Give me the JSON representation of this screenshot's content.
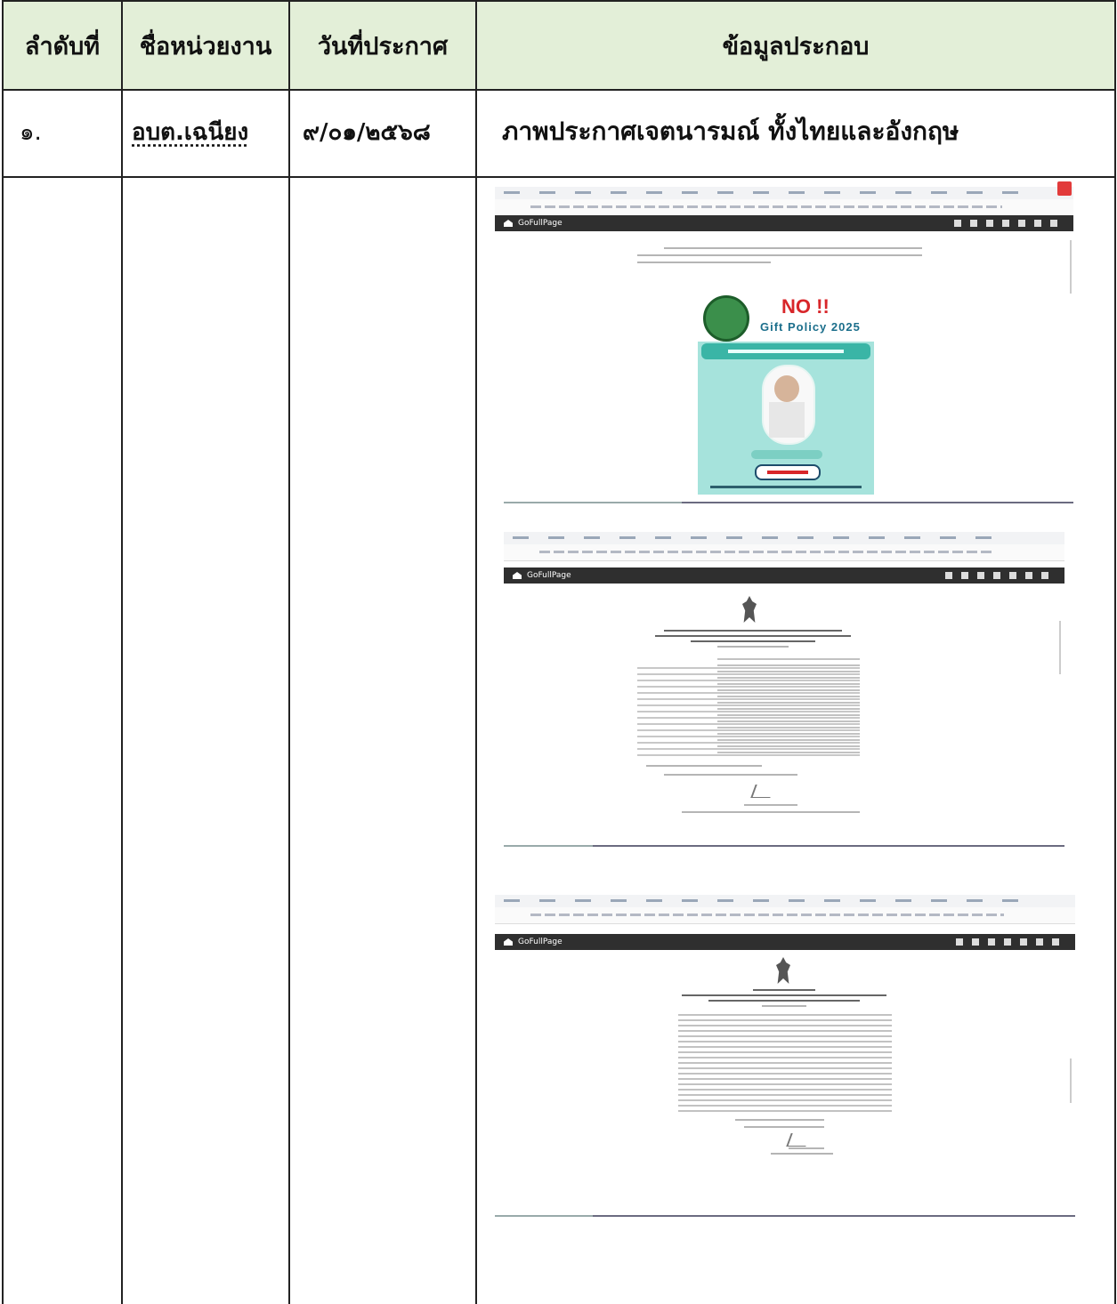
{
  "table": {
    "headers": {
      "order": "ลำดับที่",
      "unit": "ชื่อหน่วยงาน",
      "date": "วันที่ประกาศ",
      "info": "ข้อมูลประกอบ"
    },
    "rows": [
      {
        "order": "๑.",
        "unit": "อบต.เฉนียง",
        "date": "๙/๐๑/๒๕๖๘",
        "info": "ภาพประกาศเจตนารมณ์ ทั้งไทยและอังกฤษ"
      }
    ]
  },
  "screenshots": [
    {
      "app_title": "GoFullPage",
      "poster_headline": "NO !!",
      "poster_subtitle": "Gift Policy 2025"
    },
    {
      "app_title": "GoFullPage"
    },
    {
      "app_title": "GoFullPage"
    }
  ],
  "colors": {
    "header_bg": "#e3efd8",
    "border": "#222222",
    "poster_bg": "#a6e3dc",
    "poster_red": "#d8262a"
  }
}
